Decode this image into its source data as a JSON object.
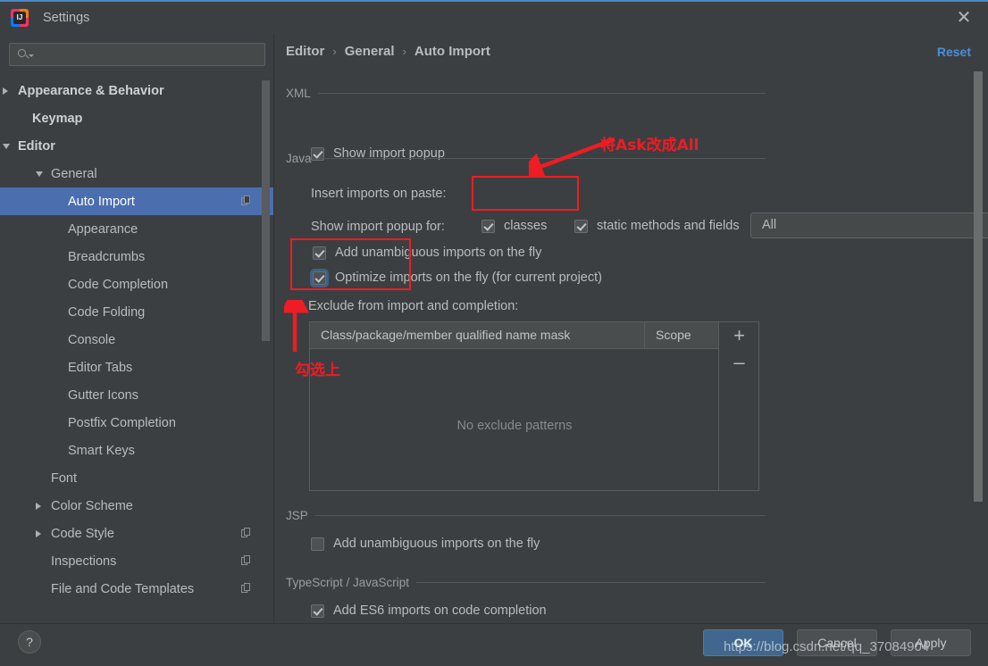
{
  "window": {
    "title": "Settings",
    "logo_text": "IJ",
    "close_icon": "close-icon"
  },
  "search": {
    "value": "",
    "placeholder": ""
  },
  "sidebar": {
    "items": [
      {
        "label": "Appearance & Behavior",
        "indent": 20,
        "arrow": "collapsed",
        "bold": true,
        "selected": false,
        "copy": false
      },
      {
        "label": "Keymap",
        "indent": 36,
        "arrow": "none",
        "bold": true,
        "selected": false,
        "copy": false
      },
      {
        "label": "Editor",
        "indent": 20,
        "arrow": "expanded",
        "bold": true,
        "selected": false,
        "copy": false
      },
      {
        "label": "General",
        "indent": 57,
        "arrow": "expanded",
        "bold": false,
        "selected": false,
        "copy": false
      },
      {
        "label": "Auto Import",
        "indent": 76,
        "arrow": "none",
        "bold": false,
        "selected": true,
        "copy": true
      },
      {
        "label": "Appearance",
        "indent": 76,
        "arrow": "none",
        "bold": false,
        "selected": false,
        "copy": false
      },
      {
        "label": "Breadcrumbs",
        "indent": 76,
        "arrow": "none",
        "bold": false,
        "selected": false,
        "copy": false
      },
      {
        "label": "Code Completion",
        "indent": 76,
        "arrow": "none",
        "bold": false,
        "selected": false,
        "copy": false
      },
      {
        "label": "Code Folding",
        "indent": 76,
        "arrow": "none",
        "bold": false,
        "selected": false,
        "copy": false
      },
      {
        "label": "Console",
        "indent": 76,
        "arrow": "none",
        "bold": false,
        "selected": false,
        "copy": false
      },
      {
        "label": "Editor Tabs",
        "indent": 76,
        "arrow": "none",
        "bold": false,
        "selected": false,
        "copy": false
      },
      {
        "label": "Gutter Icons",
        "indent": 76,
        "arrow": "none",
        "bold": false,
        "selected": false,
        "copy": false
      },
      {
        "label": "Postfix Completion",
        "indent": 76,
        "arrow": "none",
        "bold": false,
        "selected": false,
        "copy": false
      },
      {
        "label": "Smart Keys",
        "indent": 76,
        "arrow": "none",
        "bold": false,
        "selected": false,
        "copy": false
      },
      {
        "label": "Font",
        "indent": 57,
        "arrow": "none",
        "bold": false,
        "selected": false,
        "copy": false
      },
      {
        "label": "Color Scheme",
        "indent": 57,
        "arrow": "collapsed",
        "bold": false,
        "selected": false,
        "copy": false
      },
      {
        "label": "Code Style",
        "indent": 57,
        "arrow": "collapsed",
        "bold": false,
        "selected": false,
        "copy": true
      },
      {
        "label": "Inspections",
        "indent": 57,
        "arrow": "none",
        "bold": false,
        "selected": false,
        "copy": true
      },
      {
        "label": "File and Code Templates",
        "indent": 57,
        "arrow": "none",
        "bold": false,
        "selected": false,
        "copy": true
      }
    ]
  },
  "breadcrumb": {
    "crumb1": "Editor",
    "crumb2": "General",
    "crumb3": "Auto Import",
    "separator": "›"
  },
  "reset": {
    "label": "Reset"
  },
  "sections": {
    "xml": {
      "title": "XML",
      "show_import_popup": "Show import popup"
    },
    "java": {
      "title": "Java",
      "insert_imports_label": "Insert imports on paste:",
      "insert_imports_value": "All",
      "show_import_popup_for": "Show import popup for:",
      "classes": "classes",
      "static_methods": "static methods and fields",
      "add_unambiguous": "Add unambiguous imports on the fly",
      "optimize_imports": "Optimize imports on the fly (for current project)",
      "exclude_label": "Exclude from import and completion:"
    },
    "jsp": {
      "title": "JSP",
      "add_unambiguous": "Add unambiguous imports on the fly"
    },
    "typescript": {
      "title": "TypeScript / JavaScript",
      "add_es6": "Add ES6 imports on code completion"
    }
  },
  "exclude_table": {
    "col1": "Class/package/member qualified name mask",
    "col2": "Scope",
    "empty_text": "No exclude patterns",
    "add_icon": "+",
    "remove_icon": "–"
  },
  "footer": {
    "help": "?",
    "ok": "OK",
    "cancel": "Cancel",
    "apply": "Apply"
  },
  "annotations": {
    "note1": "将Ask改成All",
    "note2": "勾选上"
  },
  "watermark": {
    "url": "https://blog.csdn.net/qq_37084904"
  },
  "colors": {
    "accent_blue": "#4b6eaf",
    "link_blue": "#4a90d9",
    "annotation_red": "#ee1c25",
    "panel_bg": "#3c3f41",
    "ok_button": "#41678f"
  }
}
